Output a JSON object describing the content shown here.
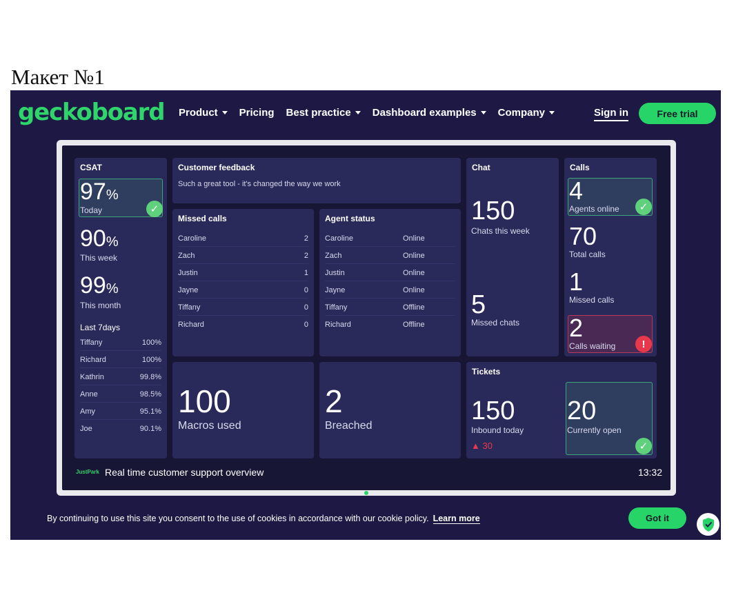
{
  "doc_title": "Макет №1",
  "header": {
    "logo": "geckoboard",
    "nav": [
      "Product",
      "Pricing",
      "Best practice",
      "Dashboard examples",
      "Company"
    ],
    "sign_in": "Sign in",
    "free_trial": "Free trial"
  },
  "csat": {
    "title": "CSAT",
    "today_value": "97",
    "today_label": "Today",
    "week_value": "90",
    "week_label": "This week",
    "month_value": "99",
    "month_label": "This month",
    "pct": "%",
    "last7_title": "Last 7days",
    "rows": [
      {
        "name": "Tiffany",
        "value": "100%"
      },
      {
        "name": "Richard",
        "value": "100%"
      },
      {
        "name": "Kathrin",
        "value": "99.8%"
      },
      {
        "name": "Anne",
        "value": "98.5%"
      },
      {
        "name": "Amy",
        "value": "95.1%"
      },
      {
        "name": "Joe",
        "value": "90.1%"
      }
    ]
  },
  "feedback": {
    "title": "Customer feedback",
    "text": "Such a great tool - it's changed the way we work"
  },
  "missed_calls": {
    "title": "Missed calls",
    "rows": [
      {
        "name": "Caroline",
        "value": "2"
      },
      {
        "name": "Zach",
        "value": "2"
      },
      {
        "name": "Justin",
        "value": "1"
      },
      {
        "name": "Jayne",
        "value": "0"
      },
      {
        "name": "Tiffany",
        "value": "0"
      },
      {
        "name": "Richard",
        "value": "0"
      }
    ]
  },
  "agent_status": {
    "title": "Agent status",
    "rows": [
      {
        "name": "Caroline",
        "status": "Online"
      },
      {
        "name": "Zach",
        "status": "Online"
      },
      {
        "name": "Justin",
        "status": "Online"
      },
      {
        "name": "Jayne",
        "status": "Online"
      },
      {
        "name": "Tiffany",
        "status": "Offline"
      },
      {
        "name": "Richard",
        "status": "Offline"
      }
    ]
  },
  "macros": {
    "value": "100",
    "label": "Macros used"
  },
  "breached": {
    "value": "2",
    "label": "Breached"
  },
  "chat": {
    "title": "Chat",
    "week_value": "150",
    "week_label": "Chats this week",
    "missed_value": "5",
    "missed_label": "Missed chats"
  },
  "calls": {
    "title": "Calls",
    "agents_value": "4",
    "agents_label": "Agents online",
    "total_value": "70",
    "total_label": "Total calls",
    "missed_value": "1",
    "missed_label": "Missed calls",
    "waiting_value": "2",
    "waiting_label": "Calls waiting"
  },
  "tickets": {
    "title": "Tickets",
    "inbound_value": "150",
    "inbound_label": "Inbound today",
    "delta": "▲ 30",
    "open_value": "20",
    "open_label": "Currently open"
  },
  "footer": {
    "brand": "JustPark",
    "title": "Real time customer support overview",
    "time": "13:32"
  },
  "cookie": {
    "text": "By continuing to use this site you consent to the use of cookies in accordance with our cookie policy.",
    "link": "Learn more",
    "button": "Got it"
  },
  "colors": {
    "accent": "#27d467",
    "background": "#1d1944",
    "panel": "#2a2a5a",
    "alert": "#e8384c"
  }
}
